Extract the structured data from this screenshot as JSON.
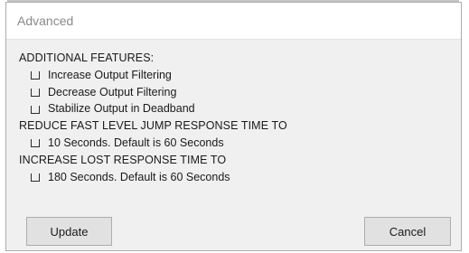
{
  "dialog": {
    "title": "Advanced"
  },
  "sections": {
    "additional_features": {
      "heading": "ADDITIONAL FEATURES:",
      "options": [
        {
          "label": "Increase Output Filtering",
          "checked": false
        },
        {
          "label": "Decrease Output Filtering",
          "checked": false
        },
        {
          "label": "Stabilize Output in Deadband",
          "checked": false
        }
      ]
    },
    "reduce_jump": {
      "heading": "REDUCE FAST LEVEL JUMP RESPONSE TIME TO",
      "options": [
        {
          "label": "10 Seconds. Default is 60 Seconds",
          "checked": false
        }
      ]
    },
    "increase_lost": {
      "heading": "INCREASE LOST RESPONSE TIME TO",
      "options": [
        {
          "label": "180 Seconds. Default is 60 Seconds",
          "checked": false
        }
      ]
    }
  },
  "buttons": {
    "update_label": "Update",
    "cancel_label": "Cancel"
  }
}
